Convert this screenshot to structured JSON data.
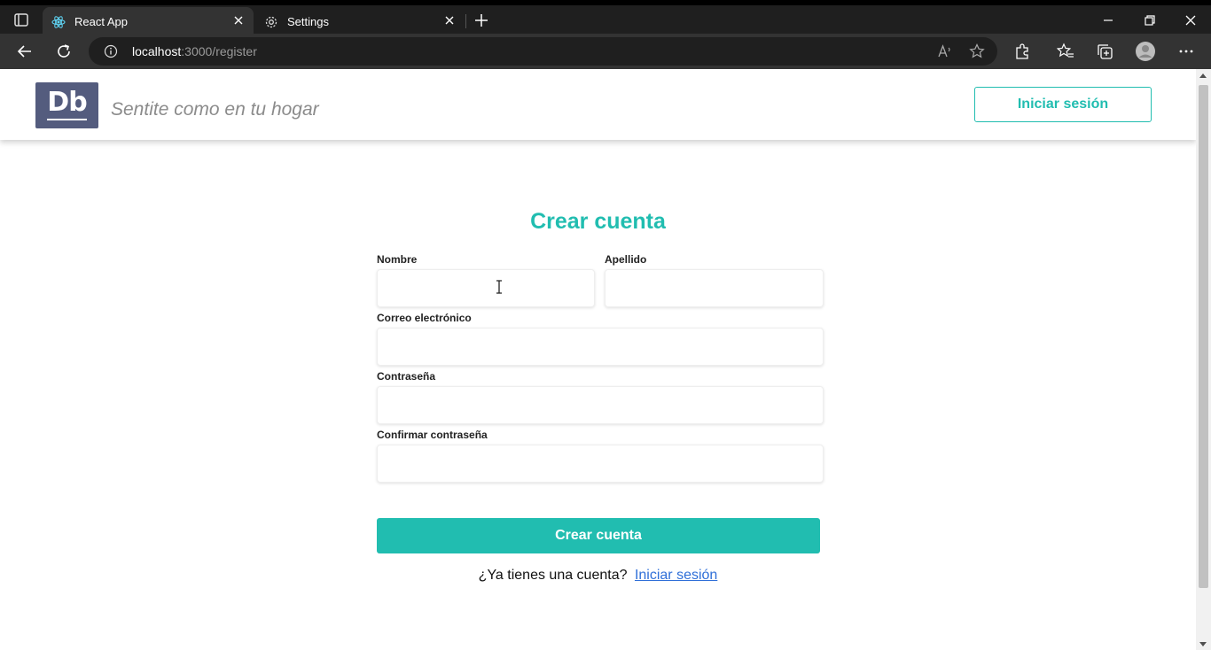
{
  "browser": {
    "tabs": [
      {
        "title": "React App",
        "icon": "react-icon",
        "active": true
      },
      {
        "title": "Settings",
        "icon": "gear-icon",
        "active": false
      }
    ],
    "address": {
      "host": "localhost",
      "path": ":3000/register"
    }
  },
  "header": {
    "logo_text": "Db",
    "tagline": "Sentite como en tu hogar",
    "login_button": "Iniciar sesión"
  },
  "form": {
    "title": "Crear cuenta",
    "fields": {
      "first_name": {
        "label": "Nombre",
        "value": ""
      },
      "last_name": {
        "label": "Apellido",
        "value": ""
      },
      "email": {
        "label": "Correo electrónico",
        "value": ""
      },
      "password": {
        "label": "Contraseña",
        "value": ""
      },
      "confirm_password": {
        "label": "Confirmar contraseña",
        "value": ""
      }
    },
    "submit_label": "Crear cuenta",
    "login_prompt": "¿Ya tienes una cuenta?",
    "login_link": "Iniciar sesión"
  },
  "colors": {
    "accent": "#21bdb0",
    "logo_bg": "#545c7e",
    "link": "#2f6fd8"
  }
}
